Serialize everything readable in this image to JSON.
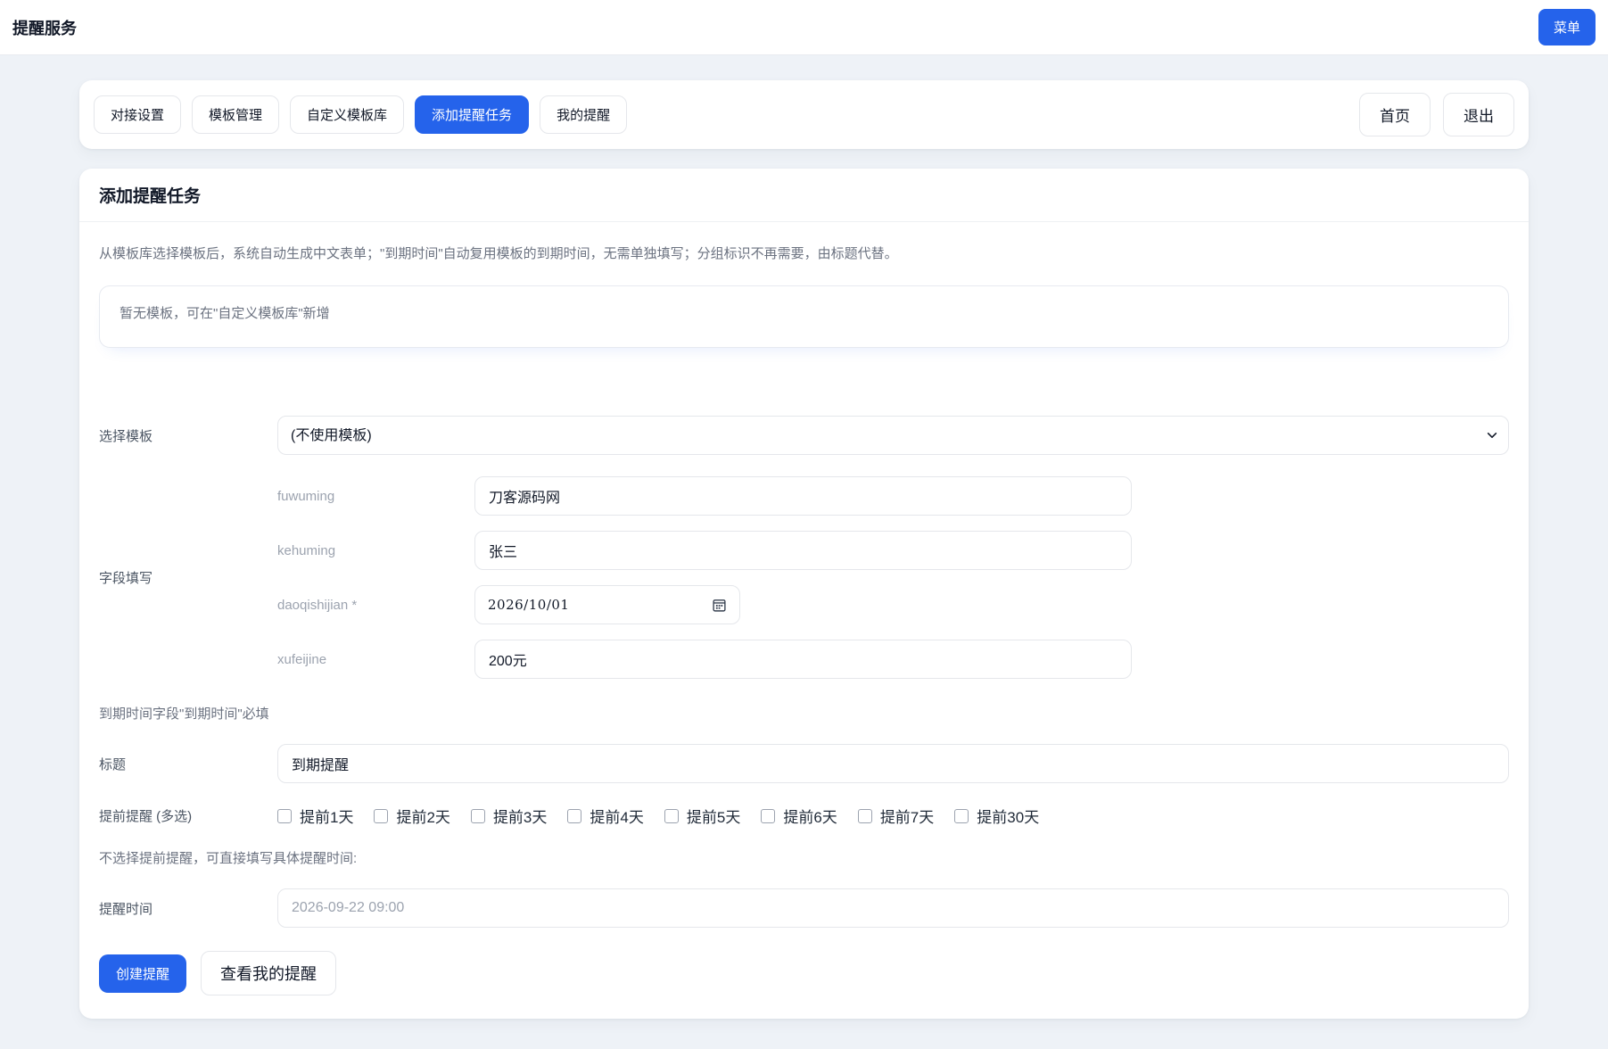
{
  "header": {
    "title": "提醒服务",
    "menu_button": "菜单"
  },
  "nav": {
    "tabs": [
      {
        "label": "对接设置"
      },
      {
        "label": "模板管理"
      },
      {
        "label": "自定义模板库"
      },
      {
        "label": "添加提醒任务"
      },
      {
        "label": "我的提醒"
      }
    ],
    "home_button": "首页",
    "logout_button": "退出"
  },
  "form": {
    "title": "添加提醒任务",
    "description": "从模板库选择模板后，系统自动生成中文表单；\"到期时间\"自动复用模板的到期时间，无需单独填写；分组标识不再需要，由标题代替。",
    "empty_template_notice": "暂无模板，可在\"自定义模板库\"新增",
    "template_select": {
      "label": "选择模板",
      "selected_option": "(不使用模板)"
    },
    "fields_section": {
      "label": "字段填写",
      "fields": [
        {
          "name": "fuwuming",
          "value": "刀客源码网"
        },
        {
          "name": "kehuming",
          "value": "张三"
        },
        {
          "name": "daoqishijian *",
          "value": "2026/10/01"
        },
        {
          "name": "xufeijine",
          "value": "200元"
        }
      ]
    },
    "due_hint": "到期时间字段\"到期时间\"必填",
    "title_field": {
      "label": "标题",
      "value": "到期提醒"
    },
    "advance_reminder": {
      "label": "提前提醒 (多选)",
      "options": [
        "提前1天",
        "提前2天",
        "提前3天",
        "提前4天",
        "提前5天",
        "提前6天",
        "提前7天",
        "提前30天"
      ]
    },
    "time_hint": "不选择提前提醒，可直接填写具体提醒时间:",
    "remind_time": {
      "label": "提醒时间",
      "placeholder": "2026-09-22 09:00"
    },
    "buttons": {
      "create": "创建提醒",
      "view_my": "查看我的提醒"
    }
  },
  "colors": {
    "accent": "#2563eb"
  }
}
